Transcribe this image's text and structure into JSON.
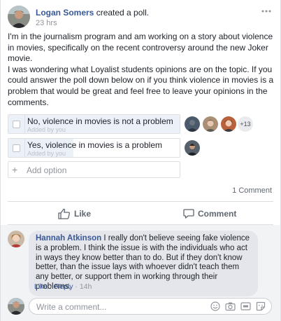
{
  "post": {
    "author": "Logan Somers",
    "action": " created a poll.",
    "timestamp": "23 hrs",
    "paragraph1": "I'm in the journalism program and am working on a story about violence in movies, specifically on the recent controversy around the new Joker movie.",
    "paragraph2": "I was wondering what Loyalist students opinions are on the topic. If you could answer the poll down below on if you think violence in movies is a problem that would be great and feel free to leave your opinions in the comments."
  },
  "poll": {
    "options": [
      {
        "label": "No, violence in movies is not a problem",
        "added_by": "Added by you",
        "share": 1.0,
        "more_voters": "+13"
      },
      {
        "label": "Yes, violence in movies is a problem",
        "added_by": "Added by you",
        "share": 0.38
      }
    ],
    "add_option_placeholder": "Add option"
  },
  "stats": {
    "comment_count": "1 Comment"
  },
  "actions": {
    "like": "Like",
    "comment": "Comment"
  },
  "comments": [
    {
      "author": "Hannah Atkinson",
      "text": " I really don't believe seeing fake violence is a problem. I think the issue is with the individuals who act in ways they know better than to do. But if they don't know better, than the issue lays with whoever didn't teach them any better, or support them in working through their problems.",
      "like": "Like",
      "separator": "·",
      "reply": "Reply",
      "time": "14h"
    }
  ],
  "composer": {
    "placeholder": "Write a comment..."
  },
  "colors": {
    "link": "#385898",
    "poll_fill": "#ecf0f7",
    "comment_bg": "#f2f3f5"
  },
  "icons": [
    "more-icon",
    "like-icon",
    "comment-icon",
    "emoji-icon",
    "camera-icon",
    "gif-icon",
    "sticker-icon"
  ]
}
